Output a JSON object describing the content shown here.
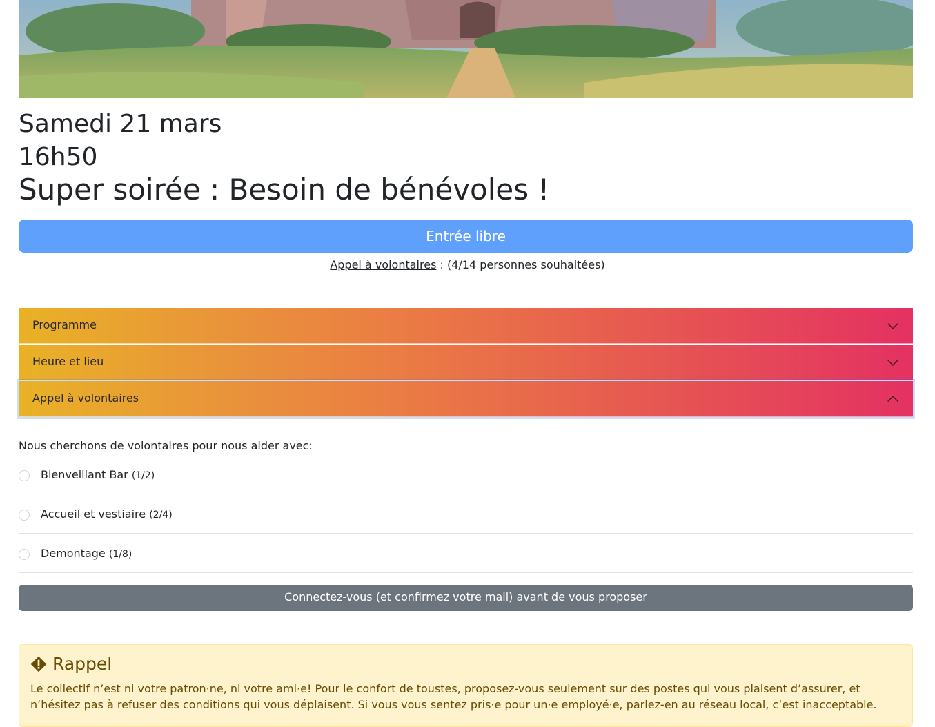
{
  "event": {
    "date": "Samedi 21 mars",
    "time": "16h50",
    "title": "Super soirée : Besoin de bénévoles !"
  },
  "entry_button": "Entrée libre",
  "volunteer_summary": {
    "link": "Appel à volontaires",
    "text": " : (4/14 personnes souhaitées)"
  },
  "accordion": [
    {
      "label": "Programme",
      "state": "collapsed"
    },
    {
      "label": "Heure et lieu",
      "state": "collapsed"
    },
    {
      "label": "Appel à volontaires",
      "state": "expanded"
    }
  ],
  "volunteers": {
    "intro": "Nous cherchons de volontaires pour nous aider avec:",
    "roles": [
      {
        "name": "Bienveillant Bar",
        "count": "(1/2)"
      },
      {
        "name": "Accueil et vestiaire",
        "count": "(2/4)"
      },
      {
        "name": "Demontage",
        "count": "(1/8)"
      }
    ],
    "login_button": "Connectez-vous (et confirmez votre mail) avant de vous proposer"
  },
  "reminder": {
    "icon": "warning-diamond-icon",
    "title": "Rappel",
    "text": "Le collectif n’est ni votre patron·ne, ni votre ami·e! Pour le confort de toustes, proposez-vous seulement sur des postes qui vous plaisent d’assurer, et n’hésitez pas à refuser des conditions qui vous déplaisent. Si vous vous sentez pris·e pour un·e employé·e, parlez-en au réseau local, c’est inacceptable."
  },
  "colors": {
    "primary": "#60a0fd",
    "secondary": "#6c757d",
    "gradient_start": "#e9b226",
    "gradient_end": "#e43162",
    "warning_bg": "#fff3cd"
  }
}
